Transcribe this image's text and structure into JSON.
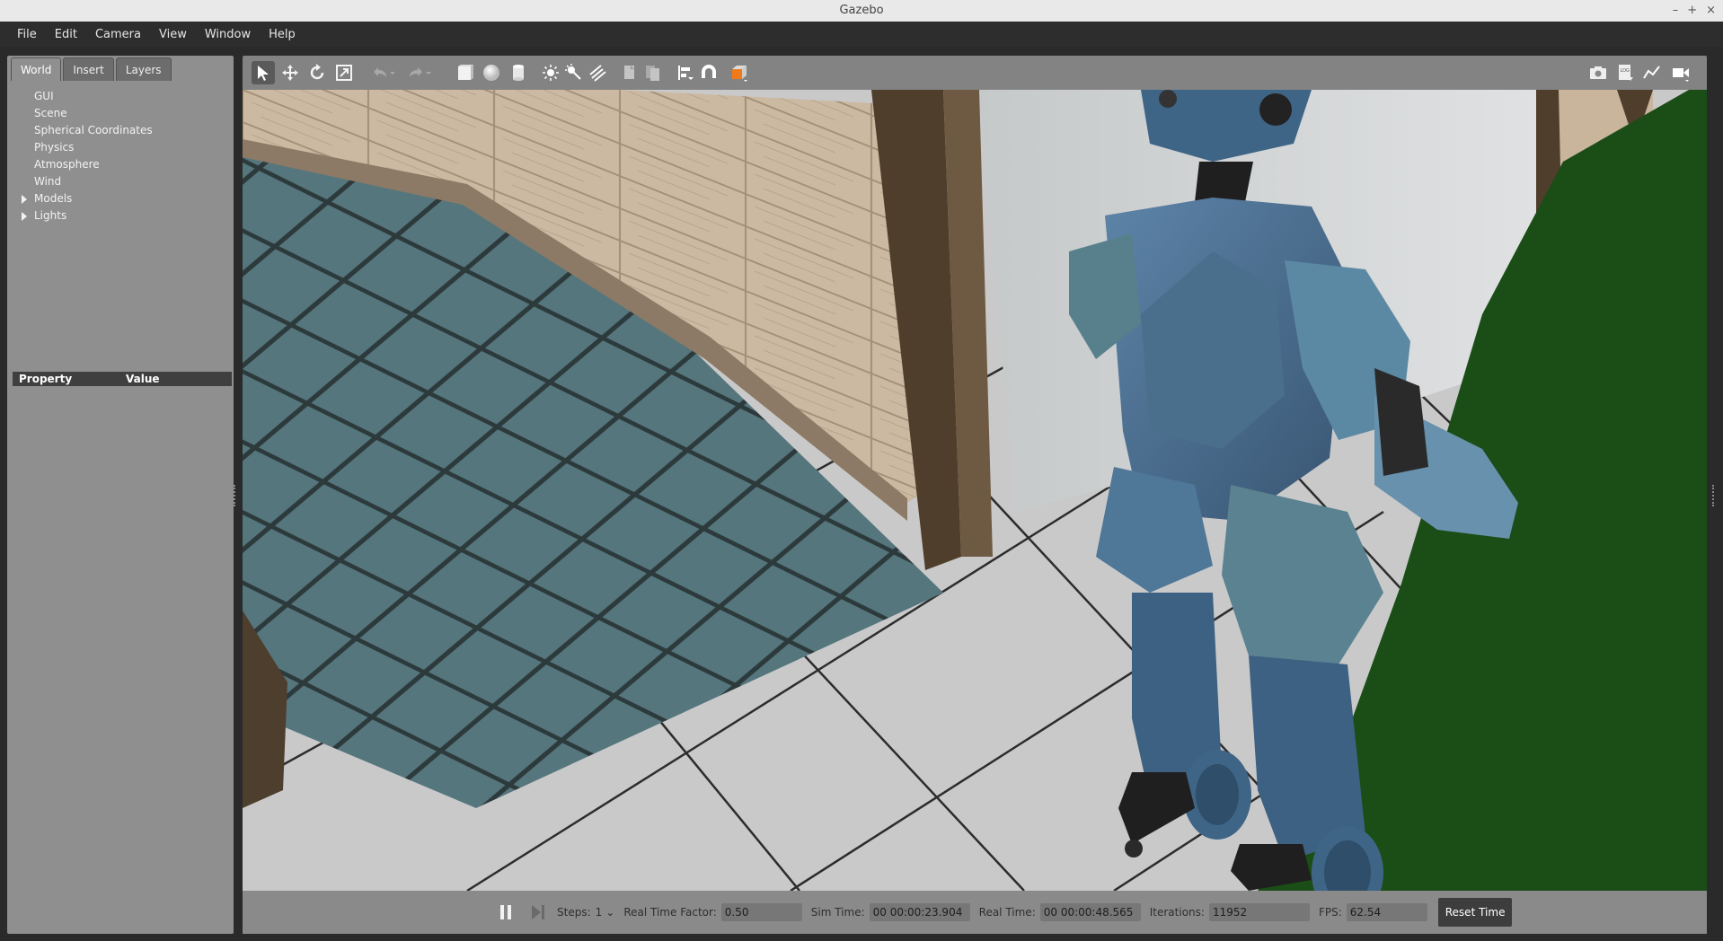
{
  "window": {
    "title": "Gazebo",
    "controls": [
      "–",
      "+",
      "×"
    ]
  },
  "menu": [
    "File",
    "Edit",
    "Camera",
    "View",
    "Window",
    "Help"
  ],
  "left_panel": {
    "tabs": [
      "World",
      "Insert",
      "Layers"
    ],
    "active_tab": "World",
    "tree": [
      {
        "label": "GUI",
        "expandable": false
      },
      {
        "label": "Scene",
        "expandable": false
      },
      {
        "label": "Spherical Coordinates",
        "expandable": false
      },
      {
        "label": "Physics",
        "expandable": false
      },
      {
        "label": "Atmosphere",
        "expandable": false
      },
      {
        "label": "Wind",
        "expandable": false
      },
      {
        "label": "Models",
        "expandable": true
      },
      {
        "label": "Lights",
        "expandable": true
      }
    ],
    "property_header": {
      "property": "Property",
      "value": "Value"
    }
  },
  "toolbar": {
    "left_tools": [
      "select-arrow-icon",
      "translate-icon",
      "rotate-icon",
      "scale-icon",
      "undo-icon",
      "redo-icon",
      "box-icon",
      "sphere-icon",
      "cylinder-icon",
      "point-light-icon",
      "spot-light-icon",
      "directional-light-icon",
      "copy-icon",
      "paste-icon",
      "align-icon",
      "magnet-snap-icon",
      "view-angle-icon"
    ],
    "right_tools": [
      "screenshot-icon",
      "log-icon",
      "plot-icon",
      "video-record-icon"
    ],
    "colors": {
      "accent": "#f07a1a",
      "selected_bg": "#5a5a5a"
    }
  },
  "bottom_bar": {
    "steps_label": "Steps:",
    "steps_value": "1",
    "rtf_label": "Real Time Factor:",
    "rtf_value": "0.50",
    "sim_time_label": "Sim Time:",
    "sim_time_value": "00 00:00:23.904",
    "real_time_label": "Real Time:",
    "real_time_value": "00 00:00:48.565",
    "iterations_label": "Iterations:",
    "iterations_value": "11952",
    "fps_label": "FPS:",
    "fps_value": "62.54",
    "reset_label": "Reset Time"
  }
}
